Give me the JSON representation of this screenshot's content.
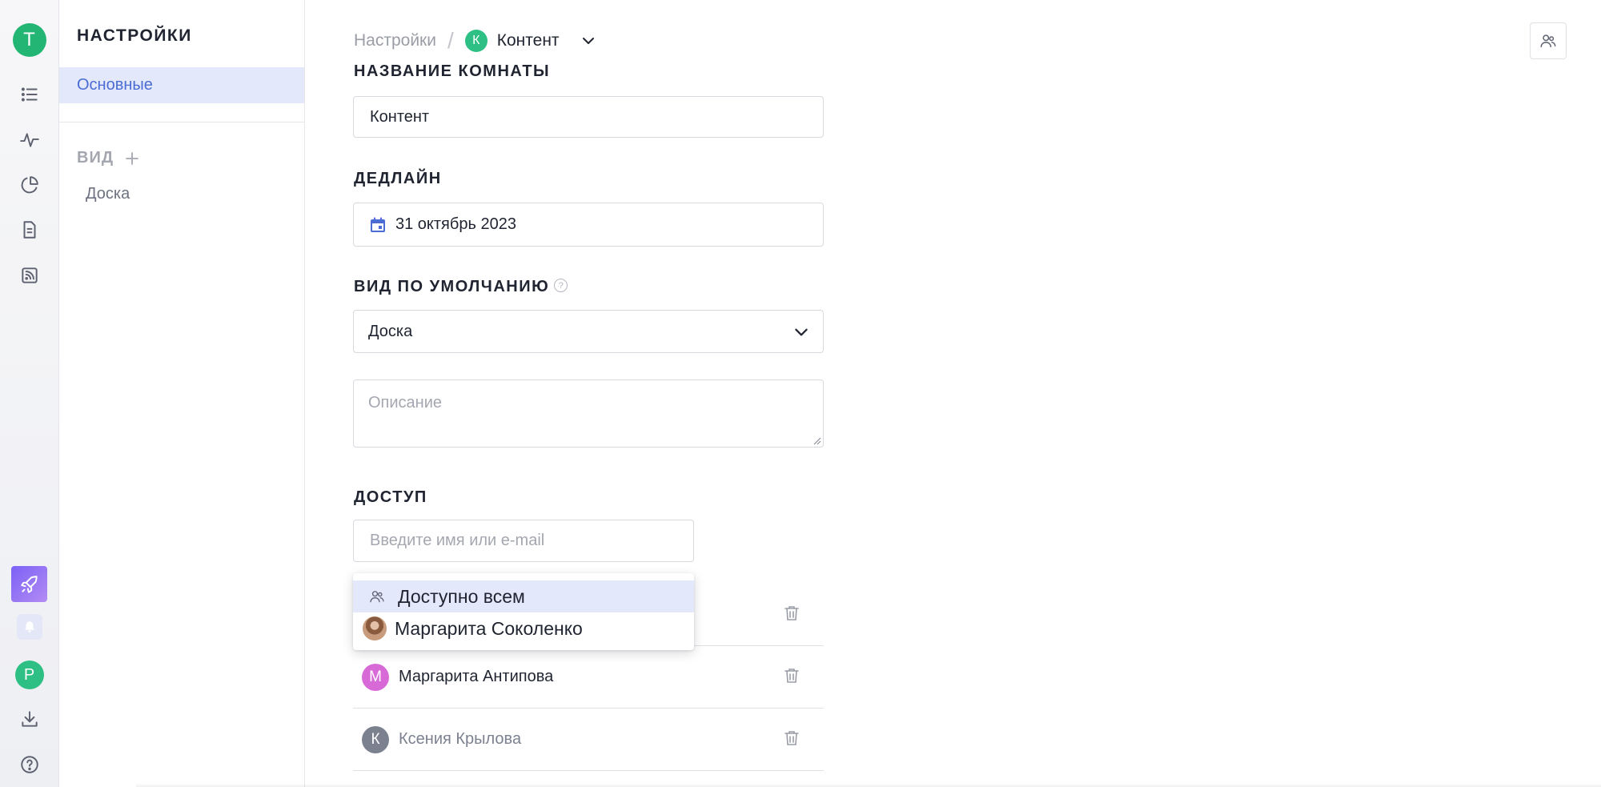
{
  "rail": {
    "user_initial": "T",
    "profile_initial": "P",
    "icons": [
      "list-icon",
      "activity-icon",
      "pie-chart-icon",
      "document-icon",
      "rss-icon",
      "rocket-icon",
      "bell-icon",
      "download-icon",
      "help-icon"
    ]
  },
  "sidebar": {
    "title": "НАСТРОЙКИ",
    "active_item": "Основные",
    "section_title": "ВИД",
    "section_items": [
      "Доска"
    ]
  },
  "breadcrumb": {
    "root": "Настройки",
    "room_initial": "К",
    "room_name": "Контент"
  },
  "form": {
    "room_name_label": "НАЗВАНИЕ КОМНАТЫ",
    "room_name_value": "Контент",
    "deadline_label": "ДЕДЛАЙН",
    "deadline_value": "31 октябрь 2023",
    "default_view_label": "ВИД ПО УМОЛЧАНИЮ",
    "help_glyph": "?",
    "default_view_value": "Доска",
    "description_placeholder": "Описание",
    "access_label": "ДОСТУП",
    "access_placeholder": "Введите имя или e-mail"
  },
  "access_dropdown": [
    {
      "label": "Доступно всем",
      "highlighted": true
    },
    {
      "label": "Маргарита Соколенко",
      "highlighted": false
    }
  ],
  "access_members": [
    {
      "initial": "М",
      "name": "Маргарита Антипова",
      "color": "#d86ad8"
    },
    {
      "initial": "К",
      "name": "Ксения Крылова",
      "color": "#7c8190"
    }
  ],
  "colors": {
    "accent": "#4a6cd4",
    "active_bg": "#e3e8fb",
    "green": "#22b573"
  }
}
